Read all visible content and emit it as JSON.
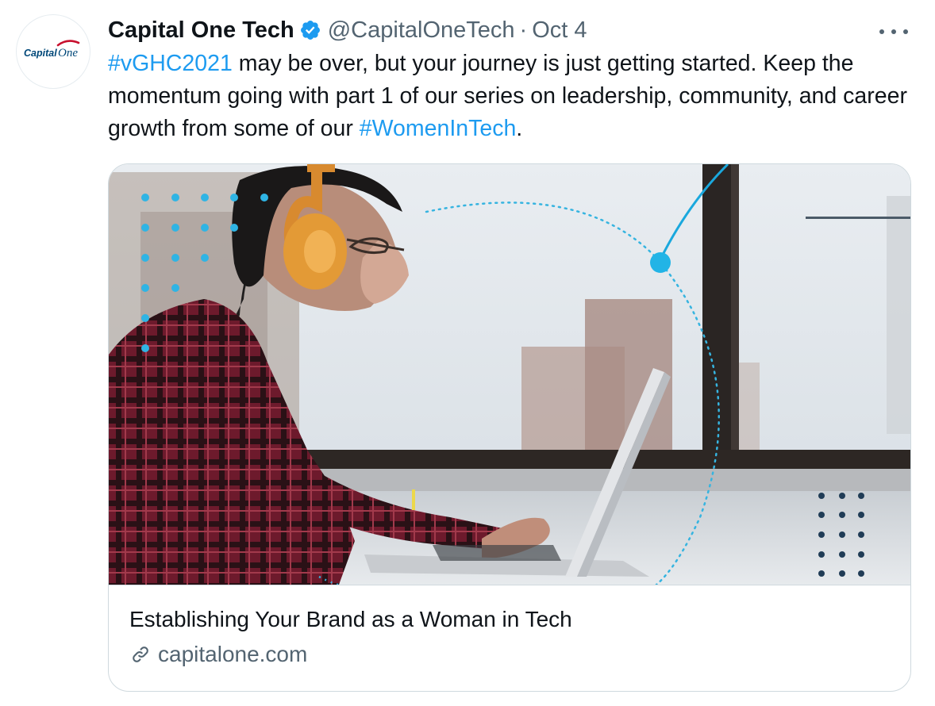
{
  "tweet": {
    "author_name": "Capital One Tech",
    "author_handle": "@CapitalOneTech",
    "separator": "·",
    "date": "Oct 4",
    "avatar_logo_text": "CapitalOne",
    "text": {
      "hashtag1": "#vGHC2021",
      "part1": " may be over, but your journey is just getting started. Keep the momentum going with part 1 of our series on leadership, community, and career growth from some of our ",
      "hashtag2": "#WomenInTech",
      "part2": "."
    },
    "card": {
      "title": "Establishing Your Brand as a Woman in Tech",
      "domain": "capitalone.com"
    }
  },
  "icons": {
    "verified": "verified-badge-icon",
    "more": "more-options-icon",
    "link": "link-icon"
  },
  "colors": {
    "accent": "#1d9bf0",
    "text_primary": "#0f1419",
    "text_secondary": "#536471",
    "brand_red": "#c8102e",
    "brand_navy": "#004879"
  }
}
